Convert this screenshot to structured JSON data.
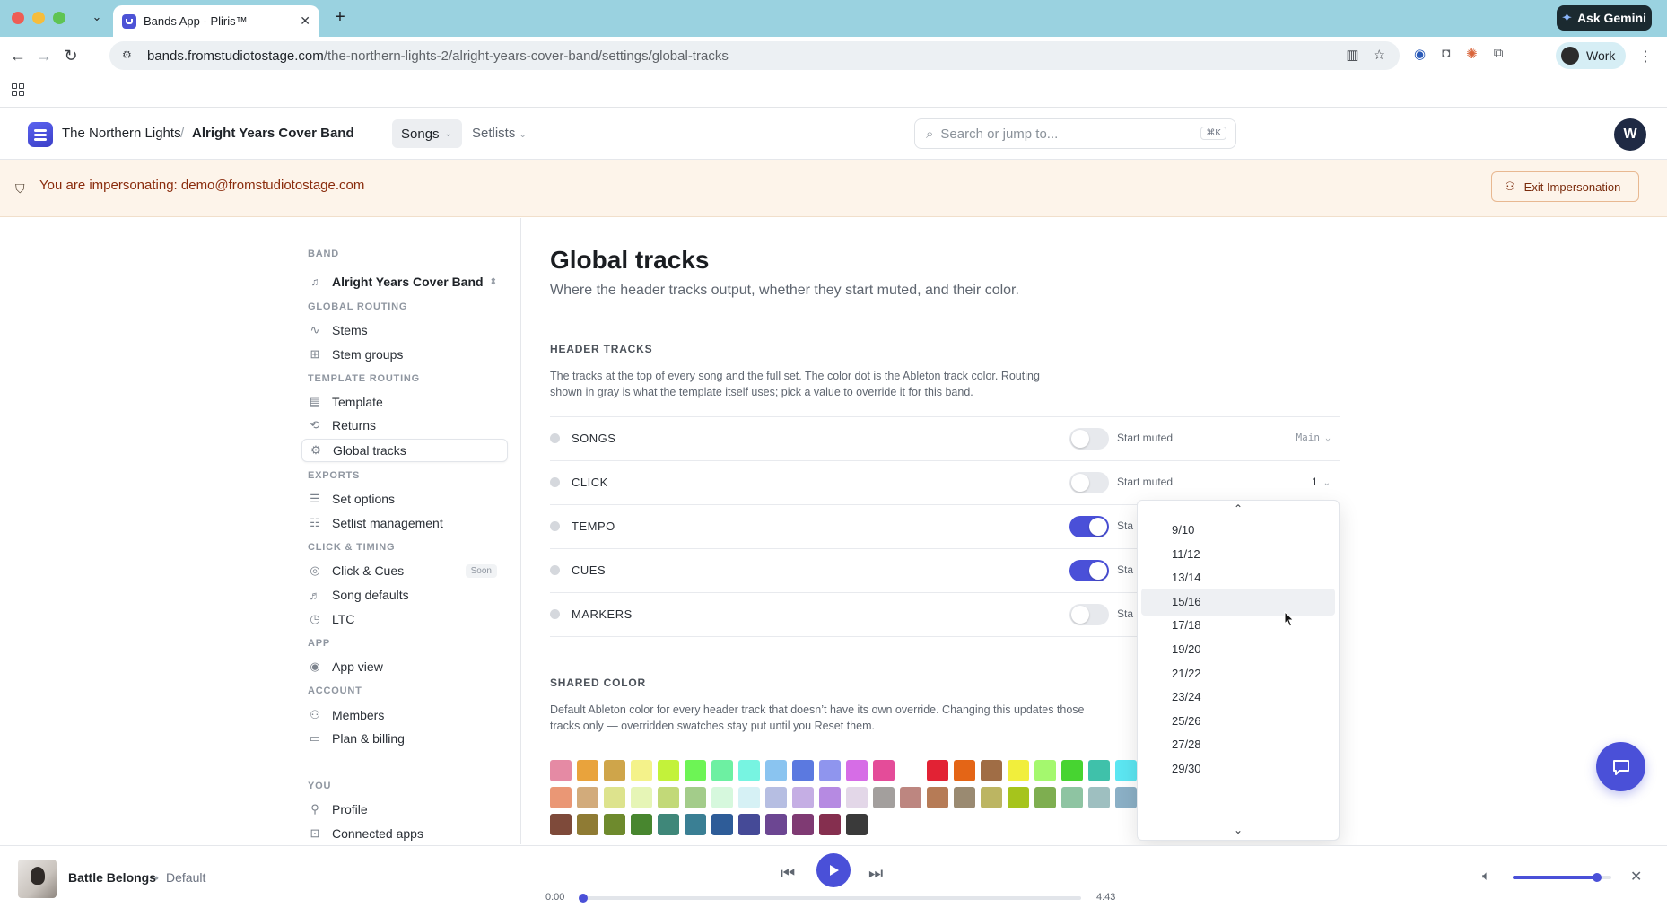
{
  "browser": {
    "tab_title": "Bands App - Pliris™",
    "url_host": "bands.fromstudiotostage.com",
    "url_path": "/the-northern-lights-2/alright-years-cover-band/settings/global-tracks",
    "ask_gemini": "Ask Gemini",
    "profile_label": "Work"
  },
  "header": {
    "band": "The Northern Lights",
    "separator": "/",
    "sub_band": "Alright Years Cover Band",
    "nav_songs": "Songs",
    "nav_setlists": "Setlists",
    "search_placeholder": "Search or jump to...",
    "search_shortcut": "⌘K",
    "avatar_initial": "W"
  },
  "impersonation": {
    "text": "You are impersonating: demo@fromstudiotostage.com",
    "exit_label": "Exit Impersonation"
  },
  "sidebar": {
    "band_section": "BAND",
    "band_name": "Alright Years Cover Band",
    "sections": {
      "global_routing": "GLOBAL ROUTING",
      "template_routing": "TEMPLATE ROUTING",
      "exports": "EXPORTS",
      "click_timing": "CLICK & TIMING",
      "app": "APP",
      "account": "ACCOUNT",
      "you": "YOU"
    },
    "items": {
      "stems": "Stems",
      "stem_groups": "Stem groups",
      "template": "Template",
      "returns": "Returns",
      "global_tracks": "Global tracks",
      "set_options": "Set options",
      "setlist_management": "Setlist management",
      "click_cues": "Click & Cues",
      "soon": "Soon",
      "song_defaults": "Song defaults",
      "ltc": "LTC",
      "app_view": "App view",
      "members": "Members",
      "plan_billing": "Plan & billing",
      "profile": "Profile",
      "connected_apps": "Connected apps"
    }
  },
  "main": {
    "title": "Global tracks",
    "subtitle": "Where the header tracks output, whether they start muted, and their color.",
    "header_tracks_label": "HEADER TRACKS",
    "header_tracks_desc": "The tracks at the top of every song and the full set. The color dot is the Ableton track color. Routing shown in gray is what the template itself uses; pick a value to override it for this band.",
    "start_muted_label": "Start muted",
    "start_muted_short": "Sta",
    "tracks": [
      {
        "name": "SONGS",
        "muted": false,
        "route": "Main"
      },
      {
        "name": "CLICK",
        "muted": false,
        "route": "1"
      },
      {
        "name": "TEMPO",
        "muted": true,
        "route": ""
      },
      {
        "name": "CUES",
        "muted": true,
        "route": ""
      },
      {
        "name": "MARKERS",
        "muted": false,
        "route": ""
      }
    ],
    "shared_color_label": "SHARED COLOR",
    "shared_color_desc": "Default Ableton color for every header track that doesn’t have its own override. Changing this updates those tracks only — overridden swatches stay put until you Reset them."
  },
  "swatch_colors": [
    [
      "#e58aa4",
      "#e9a33c",
      "#cfa54a",
      "#f4f28a",
      "#c3f23a",
      "#6df455",
      "#6df0a2",
      "#77f4e1",
      "#8ac4f0",
      "#5b79e0",
      "#8f95ee",
      "#d66de6",
      "#e44c99",
      "",
      "#e22234",
      "#e46516",
      "#a06d45",
      "#f1ee3c",
      "#a4f86e",
      "#47d431",
      "#3fc1aa",
      "#5ce6f2"
    ],
    [
      "#ea9775",
      "#d2ab7b",
      "#dde38d",
      "#e6f5b6",
      "#c2d978",
      "#a3cc8a",
      "#d6f8dd",
      "#d6f1f5",
      "#b6bee2",
      "#c5aee4",
      "#b68ae2",
      "#e3d7e8",
      "#a39f9d",
      "#bd8680",
      "#b67b56",
      "#9a8a71",
      "#bcb562",
      "#a6c41c",
      "#7eae50",
      "#8ec4a2",
      "#9ebfc0",
      "#8bb0c6"
    ],
    [
      "#7e4a3a",
      "#8f7b34",
      "#6e8a2d",
      "#48862f",
      "#3f8779",
      "#3a7f94",
      "#2e5c98",
      "#454a97",
      "#6c4692",
      "#7f3a73",
      "#852f4f",
      "#3a3a3a"
    ]
  ],
  "dropdown": {
    "options": [
      "9/10",
      "11/12",
      "13/14",
      "15/16",
      "17/18",
      "19/20",
      "21/22",
      "23/24",
      "25/26",
      "27/28",
      "29/30"
    ],
    "highlighted": "15/16"
  },
  "player": {
    "song_title": "Battle Belongs",
    "separator": "•",
    "version": "Default",
    "time_current": "0:00",
    "time_total": "4:43",
    "progress": 0.0,
    "volume": 0.85
  }
}
